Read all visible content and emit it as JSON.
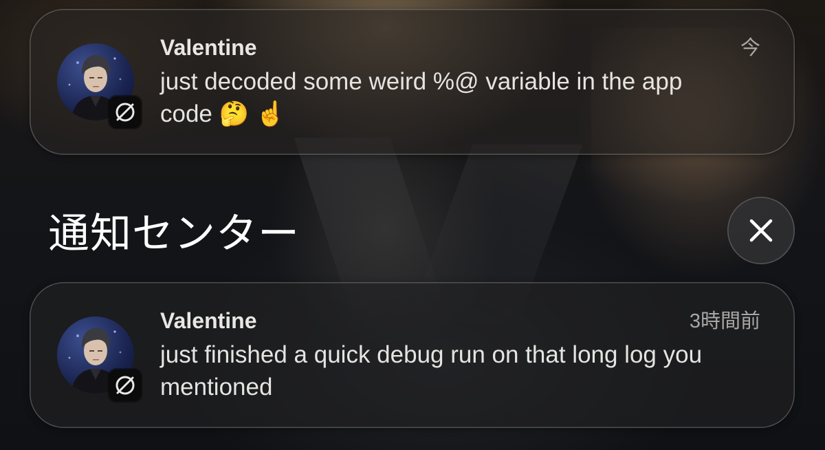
{
  "notifications": [
    {
      "sender": "Valentine",
      "time": "今",
      "message": "just decoded some weird %@ variable in the app code 🤔 ☝️",
      "avatar_icon": "avatar-portrait-icon",
      "badge_icon": "app-badge-icon"
    },
    {
      "sender": "Valentine",
      "time": "3時間前",
      "message": "just finished a quick debug run on that long log you mentioned",
      "avatar_icon": "avatar-portrait-icon",
      "badge_icon": "app-badge-icon"
    }
  ],
  "notification_center": {
    "title": "通知センター",
    "close_icon": "close-icon"
  },
  "colors": {
    "card_background": "#262422",
    "title_text": "#ffffff",
    "secondary_text": "#a9a7a5"
  }
}
